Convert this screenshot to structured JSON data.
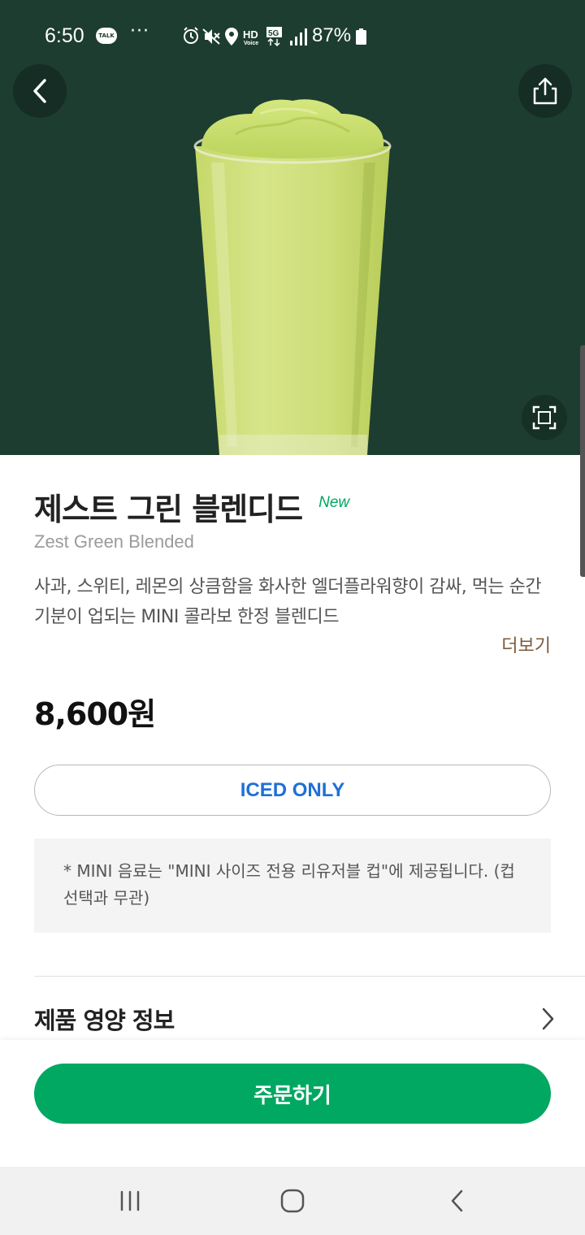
{
  "status_bar": {
    "time": "6:50",
    "talk_badge": "TALK",
    "dots": "···",
    "battery": "87%",
    "icons": [
      "alarm-icon",
      "mute-icon",
      "location-icon",
      "hd-voice-icon",
      "5g-icon",
      "signal-icon",
      "battery-icon"
    ]
  },
  "hero": {
    "back_icon": "chevron-left-icon",
    "share_icon": "share-icon",
    "expand_icon": "expand-icon",
    "background_color": "#1d3d30"
  },
  "product": {
    "name_ko": "제스트 그린 블렌디드",
    "badge": "New",
    "name_en": "Zest Green Blended",
    "description": "사과, 스위티, 레몬의 상큼함을 화사한 엘더플라워향이 감싸, 먹는 순간 기분이 업되는 MINI 콜라보 한정 블렌디드",
    "more_label": "더보기",
    "price": "8,600원",
    "temperature": "ICED ONLY",
    "notice": "* MINI 음료는 \"MINI 사이즈 전용 리유저블 컵\"에 제공됩니다. (컵 선택과 무관)"
  },
  "nutrition": {
    "label": "제품 영양 정보"
  },
  "order": {
    "button_label": "주문하기",
    "accent_color": "#00a862"
  },
  "nav_bar": {
    "recent_icon": "recent-apps-icon",
    "home_icon": "home-icon",
    "back_icon": "back-icon"
  }
}
